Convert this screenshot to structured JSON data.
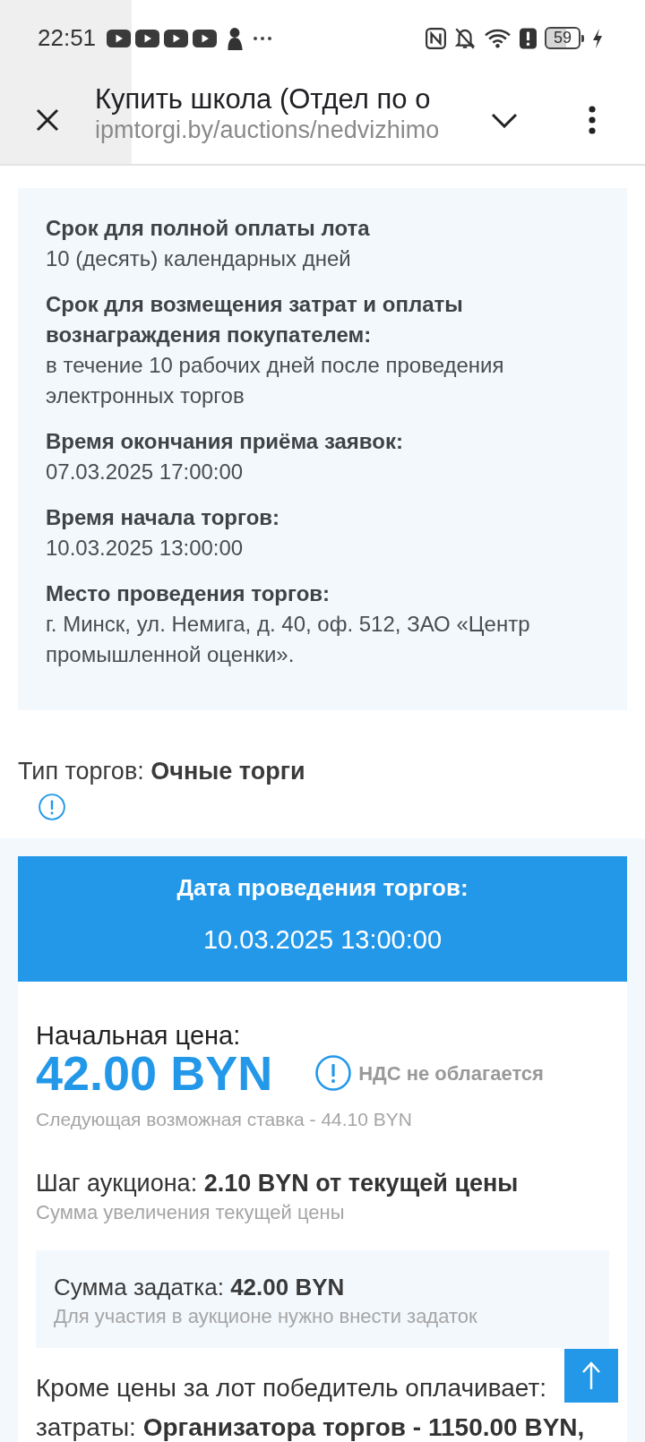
{
  "status_bar": {
    "time": "22:51",
    "battery": "59"
  },
  "browser_bar": {
    "title": "Купить школа (Отдел по о",
    "url": "ipmtorgi.by/auctions/nedvizhimo"
  },
  "terms": [
    {
      "label": "Срок для полной оплаты лота",
      "value": "10 (десять) календарных дней"
    },
    {
      "label": "Срок для возмещения затрат и оплаты вознаграждения покупателем:",
      "value": "в течение 10 рабочих дней после проведения электронных торгов"
    },
    {
      "label": "Время окончания приёма заявок:",
      "value": "07.03.2025 17:00:00"
    },
    {
      "label": "Время начала торгов:",
      "value": "10.03.2025 13:00:00"
    },
    {
      "label": "Место проведения торгов:",
      "value": "г. Минск, ул. Немига, д. 40, оф. 512, ЗАО «Центр промышленной оценки»."
    }
  ],
  "auction_type": "Тип торгов: **Очные торги**",
  "date_banner": {
    "title": "Дата проведения торгов:",
    "date": "10.03.2025 13:00:00"
  },
  "price": {
    "label": "Начальная цена:",
    "amount": "42.00 BYN",
    "vat": "НДС не облагается",
    "next_bid": "Следующая возможная ставка - 44.10 BYN"
  },
  "step": {
    "text": "Шаг аукциона: **2.10 BYN от текущей цены**",
    "hint": "Сумма увеличения текущей цены"
  },
  "deposit": {
    "text": "Сумма задатка: **42.00 BYN**",
    "hint": "Для участия в аукционе нужно внести задаток"
  },
  "extra_costs": [
    "Кроме цены за лот победитель оплачивает:",
    "затраты: **Организатора торгов - 1150.00 BYN,**"
  ]
}
